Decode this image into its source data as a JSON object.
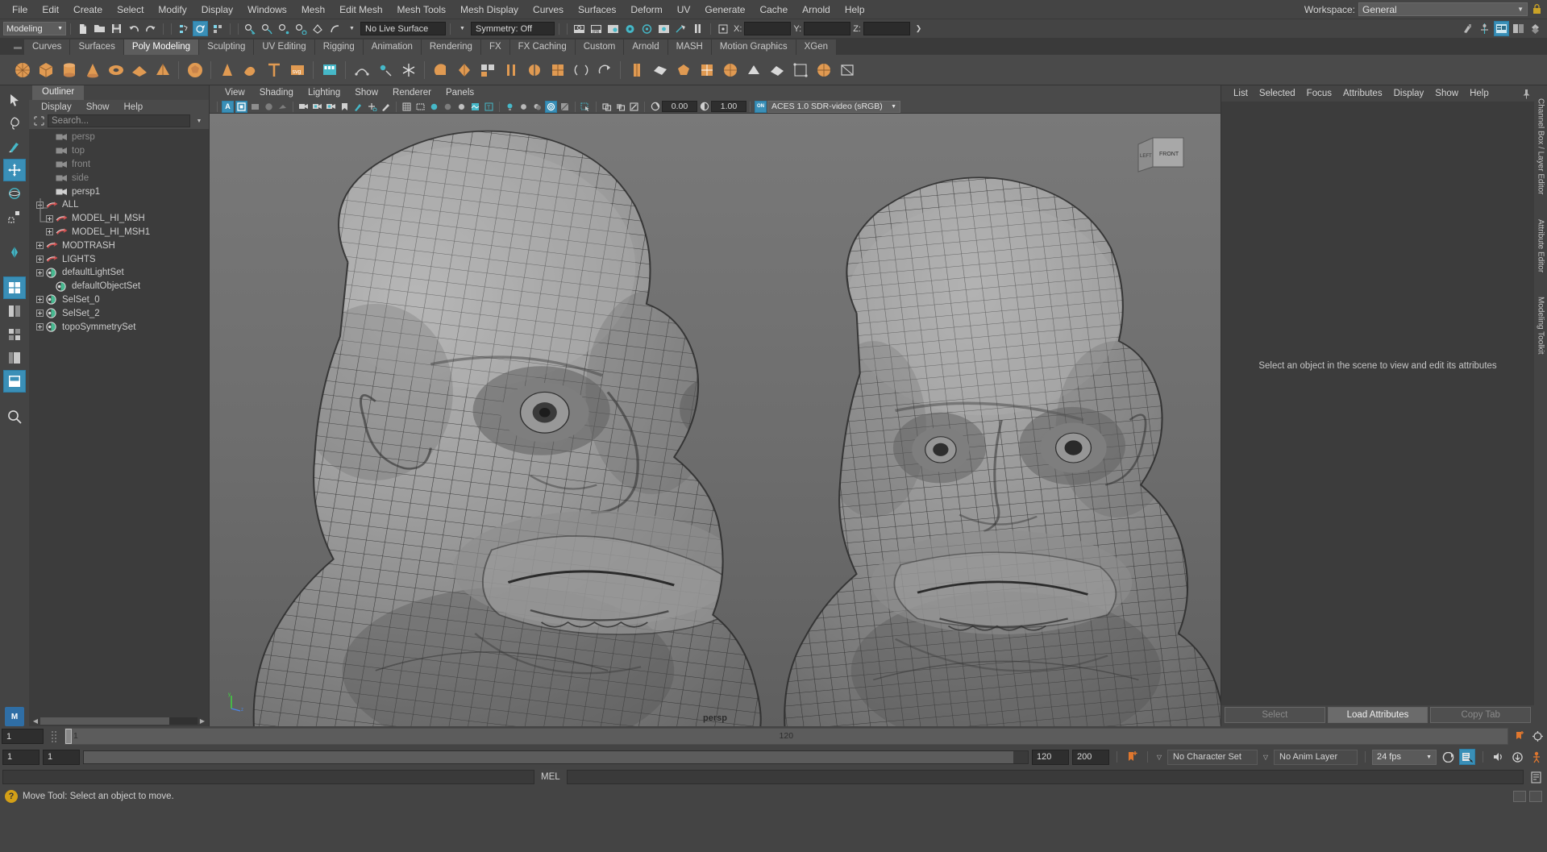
{
  "menubar": {
    "items": [
      "File",
      "Edit",
      "Create",
      "Select",
      "Modify",
      "Display",
      "Windows",
      "Mesh",
      "Edit Mesh",
      "Mesh Tools",
      "Mesh Display",
      "Curves",
      "Surfaces",
      "Deform",
      "UV",
      "Generate",
      "Cache",
      "Arnold",
      "Help"
    ],
    "workspace_label": "Workspace:",
    "workspace_value": "General"
  },
  "statusline": {
    "mode": "Modeling",
    "live_surface": "No Live Surface",
    "symmetry": "Symmetry: Off",
    "coord_x_label": "X:",
    "coord_y_label": "Y:",
    "coord_z_label": "Z:",
    "coord_x_value": "",
    "coord_y_value": "",
    "coord_z_value": ""
  },
  "shelf": {
    "tabs": [
      "Curves",
      "Surfaces",
      "Poly Modeling",
      "Sculpting",
      "UV Editing",
      "Rigging",
      "Animation",
      "Rendering",
      "FX",
      "FX Caching",
      "Custom",
      "Arnold",
      "MASH",
      "Motion Graphics",
      "XGen"
    ],
    "active_tab": "Poly Modeling"
  },
  "outliner": {
    "tab_label": "Outliner",
    "menus": [
      "Display",
      "Show",
      "Help"
    ],
    "search_placeholder": "Search...",
    "items": [
      {
        "label": "persp",
        "icon": "camera-icon",
        "indent": 1,
        "expander": "none",
        "dim": true
      },
      {
        "label": "top",
        "icon": "camera-icon",
        "indent": 1,
        "expander": "none",
        "dim": true
      },
      {
        "label": "front",
        "icon": "camera-icon",
        "indent": 1,
        "expander": "none",
        "dim": true
      },
      {
        "label": "side",
        "icon": "camera-icon",
        "indent": 1,
        "expander": "none",
        "dim": true
      },
      {
        "label": "persp1",
        "icon": "camera-icon",
        "indent": 1,
        "expander": "none",
        "dim": false
      },
      {
        "label": "ALL",
        "icon": "group-icon",
        "indent": 0,
        "expander": "minus",
        "dim": false
      },
      {
        "label": "MODEL_HI_MSH",
        "icon": "group-icon",
        "indent": 1,
        "expander": "plus",
        "dim": false
      },
      {
        "label": "MODEL_HI_MSH1",
        "icon": "group-icon",
        "indent": 1,
        "expander": "plus",
        "dim": false
      },
      {
        "label": "MODTRASH",
        "icon": "group-icon",
        "indent": 0,
        "expander": "plus",
        "dim": false
      },
      {
        "label": "LIGHTS",
        "icon": "group-icon",
        "indent": 0,
        "expander": "plus",
        "dim": false
      },
      {
        "label": "defaultLightSet",
        "icon": "set-icon",
        "indent": 0,
        "expander": "plus",
        "dim": false
      },
      {
        "label": "defaultObjectSet",
        "icon": "set-icon",
        "indent": 1,
        "expander": "none",
        "dim": false
      },
      {
        "label": "SelSet_0",
        "icon": "set-icon",
        "indent": 0,
        "expander": "plus",
        "dim": false
      },
      {
        "label": "SelSet_2",
        "icon": "set-icon",
        "indent": 0,
        "expander": "plus",
        "dim": false
      },
      {
        "label": "topoSymmetrySet",
        "icon": "set-icon",
        "indent": 0,
        "expander": "plus",
        "dim": false
      }
    ]
  },
  "viewport": {
    "menus": [
      "View",
      "Shading",
      "Lighting",
      "Show",
      "Renderer",
      "Panels"
    ],
    "exposure": "0.00",
    "gamma": "1.00",
    "color_space": "ACES 1.0 SDR-video (sRGB)",
    "camera_label": "persp",
    "viewcube_left": "LEFT",
    "viewcube_front": "FRONT"
  },
  "attribute_editor": {
    "menus": [
      "List",
      "Selected",
      "Focus",
      "Attributes",
      "Display",
      "Show",
      "Help"
    ],
    "empty_message": "Select an object in the scene to view and edit its attributes",
    "buttons": {
      "select": "Select",
      "load": "Load Attributes",
      "copy": "Copy Tab"
    }
  },
  "right_tabs": [
    "Channel Box / Layer Editor",
    "Attribute Editor",
    "Modeling Toolkit"
  ],
  "timeslider": {
    "current_frame": "1",
    "start_field": "1",
    "playback_end": "120",
    "range_end": "200"
  },
  "rangeslider": {
    "character_set": "No Character Set",
    "anim_layer": "No Anim Layer",
    "fps": "24 fps"
  },
  "commandline": {
    "label": "MEL",
    "input_value": ""
  },
  "helpline": {
    "text": "Move Tool: Select an object to move."
  },
  "colors": {
    "accent": "#3a8fb7",
    "shelf_orange": "#e09a52",
    "panel_bg": "#444444",
    "list_bg": "#3c3c3c"
  }
}
